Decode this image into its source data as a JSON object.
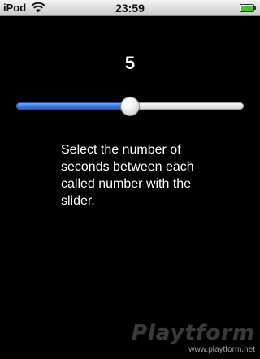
{
  "status_bar": {
    "carrier": "iPod",
    "time": "23:59"
  },
  "icons": {
    "wifi": "wifi-icon",
    "battery": "battery-icon"
  },
  "colors": {
    "slider_fill": "#3a7be0",
    "background": "#000000"
  },
  "slider": {
    "value_label": "5",
    "fill_fraction": 0.5
  },
  "instructions": "Select the number of seconds between each called number with the slider.",
  "watermark": {
    "logo": "Playtform",
    "url": "www.playtform.net"
  }
}
